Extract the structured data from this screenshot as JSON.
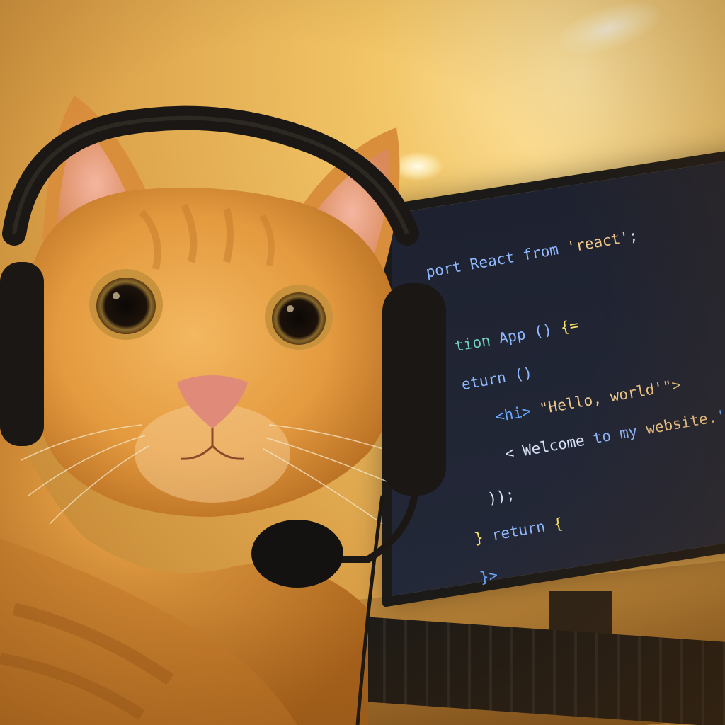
{
  "photo": {
    "subject": "cat",
    "colors": {
      "wall": "#e8b24a",
      "fur": "#e7a54b",
      "screen": "#1e2230",
      "headset": "#1a1714"
    }
  },
  "monitor": {
    "code_lines": [
      [
        {
          "t": "port React from ",
          "c": "kw"
        },
        {
          "t": "'react'",
          "c": "str"
        },
        {
          "t": ";",
          "c": "txt"
        }
      ],
      [
        {
          "t": "",
          "c": "txt"
        }
      ],
      [
        {
          "t": "tion ",
          "c": "fn"
        },
        {
          "t": "App () ",
          "c": "kw"
        },
        {
          "t": "{=",
          "c": "brace"
        }
      ],
      [
        {
          "t": "eturn ()",
          "c": "kw"
        }
      ],
      [
        {
          "t": "  <hi> ",
          "c": "tag"
        },
        {
          "t": "\"Hello, world'\">",
          "c": "str"
        }
      ],
      [
        {
          "t": "  < ",
          "c": "txt"
        },
        {
          "t": "Welcome ",
          "c": "txt"
        },
        {
          "t": "to my ",
          "c": "kw"
        },
        {
          "t": "website.",
          "c": "str"
        },
        {
          "t": "'>",
          "c": "tag"
        }
      ],
      [
        {
          "t": " ));",
          "c": "txt"
        }
      ],
      [
        {
          "t": "} ",
          "c": "brace"
        },
        {
          "t": "return ",
          "c": "kw"
        },
        {
          "t": "{",
          "c": "brace"
        }
      ],
      [
        {
          "t": "}>",
          "c": "tag"
        }
      ]
    ]
  }
}
